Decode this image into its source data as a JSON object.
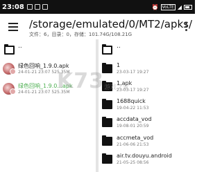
{
  "status_bar": {
    "time": "23:08",
    "icons": [
      "notification-icon",
      "gallery-icon",
      "download-icon"
    ],
    "indicators": [
      "alarm-icon",
      "volte-icon",
      "signal-icon",
      "battery-icon"
    ],
    "volte": "VoLTE"
  },
  "app_bar": {
    "path": "/storage/emulated/0/MT2/apks/",
    "summary": "文件：6，目录：0，存储：101.74G/108.21G"
  },
  "left_panel": {
    "parent": "..",
    "files": [
      {
        "name": "绿色回响_1.9.0.apk",
        "meta": "24-01-21 23:07  525.35M",
        "highlight": false
      },
      {
        "name": "绿色回响_1.9.0...apk",
        "meta": "24-01-21 23:07  525.35M",
        "highlight": true
      }
    ]
  },
  "right_panel": {
    "parent": "..",
    "folders": [
      {
        "name": "1",
        "meta": "23-03-17 19:27"
      },
      {
        "name": "1.apk",
        "meta": "23-03-17 19:27"
      },
      {
        "name": "1688quick",
        "meta": "19-04-22 11:53"
      },
      {
        "name": "accdata_vod",
        "meta": "19-08-01 20:59"
      },
      {
        "name": "accmeta_vod",
        "meta": "21-06-06 21:53"
      },
      {
        "name": "air.tv.douyu.android",
        "meta": "21-05-25 08:56"
      }
    ]
  },
  "watermark": {
    "main": "K73",
    "sub": "游戏之家"
  }
}
